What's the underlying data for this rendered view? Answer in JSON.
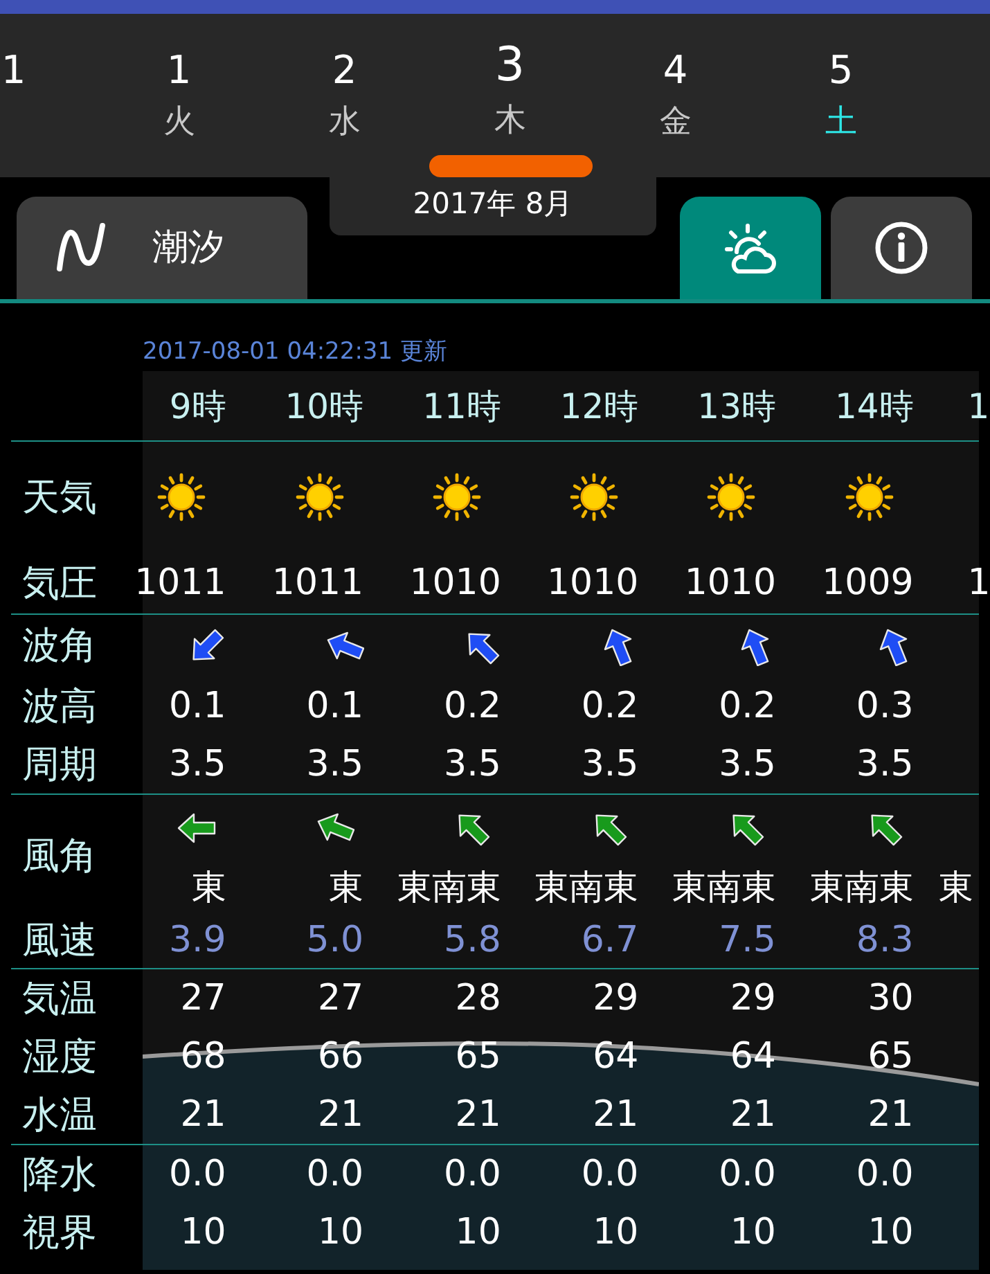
{
  "days": [
    {
      "number": "1",
      "selected": false
    },
    {
      "number": "1",
      "weekday": "火",
      "selected": false,
      "color": "#c8c8c8"
    },
    {
      "number": "2",
      "weekday": "水",
      "selected": false,
      "color": "#c8c8c8"
    },
    {
      "number": "3",
      "weekday": "木",
      "selected": true,
      "color": "#c8c8c8"
    },
    {
      "number": "4",
      "weekday": "金",
      "selected": false,
      "color": "#c8c8c8"
    },
    {
      "number": "5",
      "weekday": "土",
      "selected": false,
      "color": "#2ee6e6"
    }
  ],
  "month_label": "2017年 8月",
  "tabs": [
    {
      "kind": "tide",
      "label": "潮汐",
      "selected": false
    },
    {
      "kind": "weather",
      "selected": true
    },
    {
      "kind": "info",
      "selected": false
    }
  ],
  "updated": "2017-08-01 04:22:31 更新",
  "table": {
    "groups": [
      {
        "rows": [
          {
            "kind": "header",
            "values": [
              "9時",
              "10時",
              "11時",
              "12時",
              "13時",
              "14時",
              "1"
            ]
          }
        ]
      },
      {
        "rows": [
          {
            "kind": "weather",
            "label": "天気",
            "values": [
              {
                "kind": "sunny"
              },
              {
                "kind": "sunny"
              },
              {
                "kind": "sunny"
              },
              {
                "kind": "sunny"
              },
              {
                "kind": "sunny"
              },
              {
                "kind": "sunny"
              }
            ]
          },
          {
            "kind": "text",
            "label": "気圧",
            "values": [
              "1011",
              "1011",
              "1010",
              "1010",
              "1010",
              "1009",
              "1"
            ]
          }
        ]
      },
      {
        "rows": [
          {
            "kind": "wave_arrow",
            "label": "波角",
            "values": [
              {
                "kind": "sw"
              },
              {
                "kind": "wnw"
              },
              {
                "kind": "nw"
              },
              {
                "kind": "nnw"
              },
              {
                "kind": "nnw"
              },
              {
                "kind": "nnw"
              }
            ]
          },
          {
            "kind": "text",
            "label": "波高",
            "values": [
              "0.1",
              "0.1",
              "0.2",
              "0.2",
              "0.2",
              "0.3"
            ]
          },
          {
            "kind": "text",
            "label": "周期",
            "values": [
              "3.5",
              "3.5",
              "3.5",
              "3.5",
              "3.5",
              "3.5"
            ]
          }
        ]
      },
      {
        "rows": [
          {
            "kind": "wind_arrow",
            "label": "風角",
            "values": [
              {
                "kind": "w"
              },
              {
                "kind": "wnw"
              },
              {
                "kind": "nw"
              },
              {
                "kind": "nw"
              },
              {
                "kind": "nw"
              },
              {
                "kind": "nw"
              }
            ]
          },
          {
            "kind": "compass",
            "values": [
              "東",
              "東",
              "東南東",
              "東南東",
              "東南東",
              "東南東",
              "東"
            ]
          },
          {
            "kind": "speed",
            "label": "風速",
            "values": [
              "3.9",
              "5.0",
              "5.8",
              "6.7",
              "7.5",
              "8.3"
            ]
          }
        ]
      },
      {
        "rows": [
          {
            "kind": "text",
            "label": "気温",
            "values": [
              "27",
              "27",
              "28",
              "29",
              "29",
              "30"
            ]
          },
          {
            "kind": "text",
            "label": "湿度",
            "values": [
              "68",
              "66",
              "65",
              "64",
              "64",
              "65"
            ]
          },
          {
            "kind": "text",
            "label": "水温",
            "values": [
              "21",
              "21",
              "21",
              "21",
              "21",
              "21"
            ]
          }
        ]
      },
      {
        "rows": [
          {
            "kind": "text",
            "label": "降水",
            "values": [
              "0.0",
              "0.0",
              "0.0",
              "0.0",
              "0.0",
              "0.0"
            ]
          },
          {
            "kind": "text",
            "label": "視界",
            "values": [
              "10",
              "10",
              "10",
              "10",
              "10",
              "10"
            ]
          }
        ]
      }
    ]
  }
}
